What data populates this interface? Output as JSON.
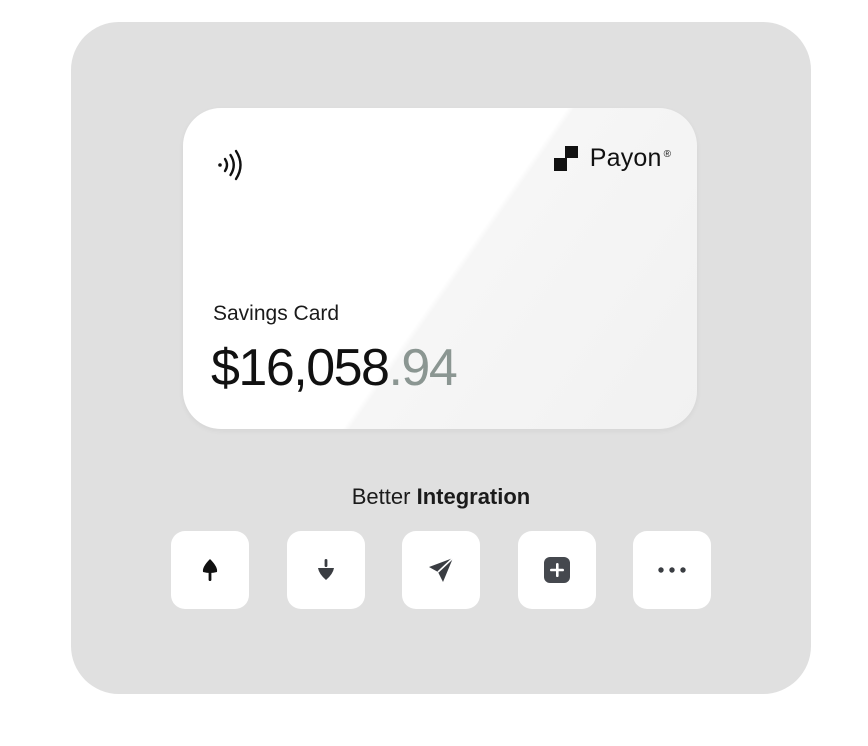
{
  "card": {
    "brand_name": "Payon",
    "brand_reg": "®",
    "label": "Savings Card",
    "balance_main": "$16,058",
    "balance_cents": ".94"
  },
  "section": {
    "title_regular": "Better",
    "title_bold": "Integration"
  },
  "actions": [
    {
      "icon": "arrow-up-icon"
    },
    {
      "icon": "arrow-down-icon"
    },
    {
      "icon": "send-icon"
    },
    {
      "icon": "add-icon"
    },
    {
      "icon": "more-icon"
    }
  ],
  "colors": {
    "panel": "#e0e0e0",
    "card": "#ffffff",
    "cents": "#8b9692",
    "icon": "#2b2f33"
  }
}
